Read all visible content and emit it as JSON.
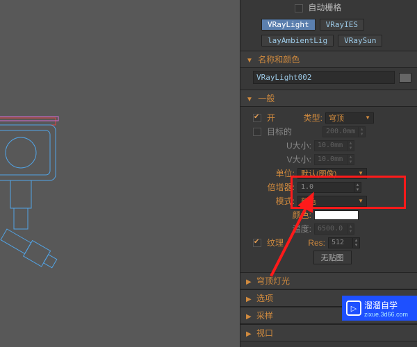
{
  "top": {
    "auto_grid": "自动栅格",
    "types": [
      "VRayLight",
      "VRayIES",
      "layAmbientLig",
      "VRaySun"
    ],
    "selected_index": 0
  },
  "sections": {
    "name_color": "名称和颜色",
    "general": "一般",
    "dome": "穹顶灯光",
    "options": "选项",
    "sampling": "采样",
    "viewport": "视口"
  },
  "name_field": "VRayLight002",
  "general": {
    "on": {
      "label": "开",
      "checked": true
    },
    "type_label": "类型:",
    "type_value": "穹顶",
    "targeted": {
      "label": "目标的",
      "checked": false,
      "dist": "200.0mm"
    },
    "u_size": {
      "label": "U大小:",
      "value": "10.0mm"
    },
    "v_size": {
      "label": "V大小:",
      "value": "10.0mm"
    },
    "units": {
      "label": "单位:",
      "value": "默认(图像)"
    },
    "multiplier": {
      "label": "倍增器:",
      "value": "1.0"
    },
    "mode": {
      "label": "模式:",
      "value": "颜色"
    },
    "color": {
      "label": "颜色:",
      "value": "#ffffff"
    },
    "temperature": {
      "label": "温度:",
      "value": "6500.0"
    },
    "texture": {
      "label": "纹理",
      "checked": true
    },
    "res": {
      "label": "Res:",
      "value": "512"
    },
    "nomap": "无贴图"
  },
  "watermark": {
    "brand": "溜溜自学",
    "url": "zixue.3d66.com"
  }
}
